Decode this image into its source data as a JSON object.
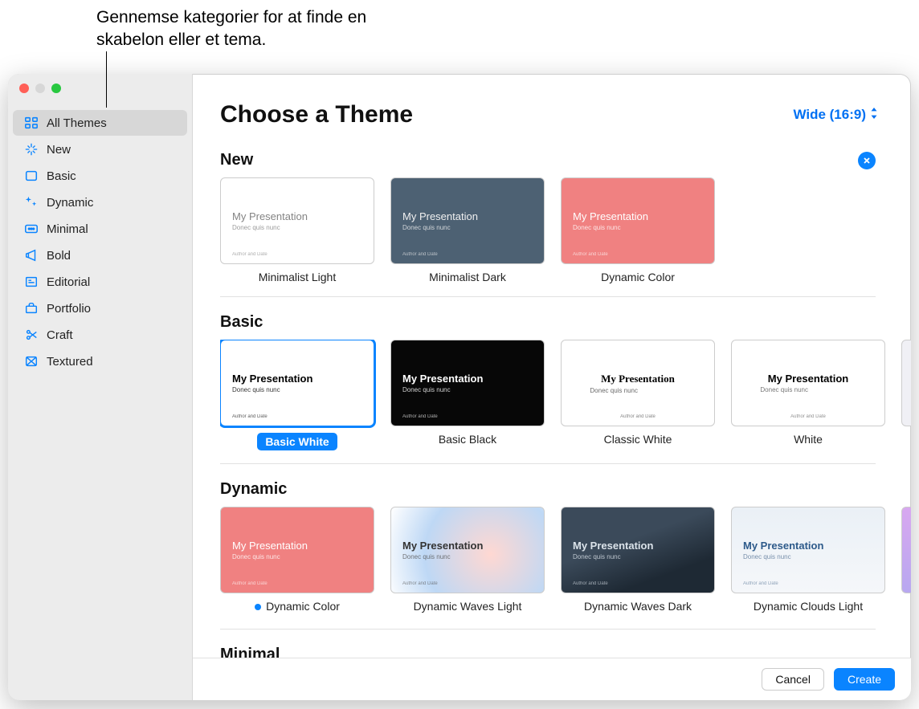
{
  "callout": "Gennemse kategorier for at finde en skabelon eller et tema.",
  "header": {
    "title": "Choose a Theme",
    "aspect": "Wide (16:9)"
  },
  "sidebar": {
    "items": [
      {
        "label": "All Themes",
        "icon": "grid-icon",
        "selected": true
      },
      {
        "label": "New",
        "icon": "sparkle-icon"
      },
      {
        "label": "Basic",
        "icon": "doc-icon"
      },
      {
        "label": "Dynamic",
        "icon": "stars-icon"
      },
      {
        "label": "Minimal",
        "icon": "ellipsis-icon"
      },
      {
        "label": "Bold",
        "icon": "megaphone-icon"
      },
      {
        "label": "Editorial",
        "icon": "news-icon"
      },
      {
        "label": "Portfolio",
        "icon": "briefcase-icon"
      },
      {
        "label": "Craft",
        "icon": "scissors-icon"
      },
      {
        "label": "Textured",
        "icon": "texture-icon"
      }
    ]
  },
  "thumb": {
    "title": "My Presentation",
    "sub": "Donec quis nunc",
    "foot": "Author and Date"
  },
  "sections": [
    {
      "title": "New",
      "closeable": true,
      "themes": [
        {
          "label": "Minimalist Light",
          "cls": "bg-minlight"
        },
        {
          "label": "Minimalist Dark",
          "cls": "bg-mindark"
        },
        {
          "label": "Dynamic Color",
          "cls": "bg-dyncolor"
        }
      ]
    },
    {
      "title": "Basic",
      "themes": [
        {
          "label": "Basic White",
          "cls": "bg-bwhite",
          "selected": true
        },
        {
          "label": "Basic Black",
          "cls": "bg-bblack"
        },
        {
          "label": "Classic White",
          "cls": "bg-classic"
        },
        {
          "label": "White",
          "cls": "bg-white2"
        }
      ],
      "overflow": "bg-sliver1"
    },
    {
      "title": "Dynamic",
      "themes": [
        {
          "label": "Dynamic Color",
          "cls": "bg-dyncolor",
          "dot": true
        },
        {
          "label": "Dynamic Waves Light",
          "cls": "bg-wlight"
        },
        {
          "label": "Dynamic Waves Dark",
          "cls": "bg-wdark"
        },
        {
          "label": "Dynamic Clouds Light",
          "cls": "bg-clouds"
        }
      ],
      "overflow": "bg-sliver2"
    },
    {
      "title": "Minimal",
      "themes": []
    }
  ],
  "footer": {
    "cancel": "Cancel",
    "create": "Create"
  }
}
